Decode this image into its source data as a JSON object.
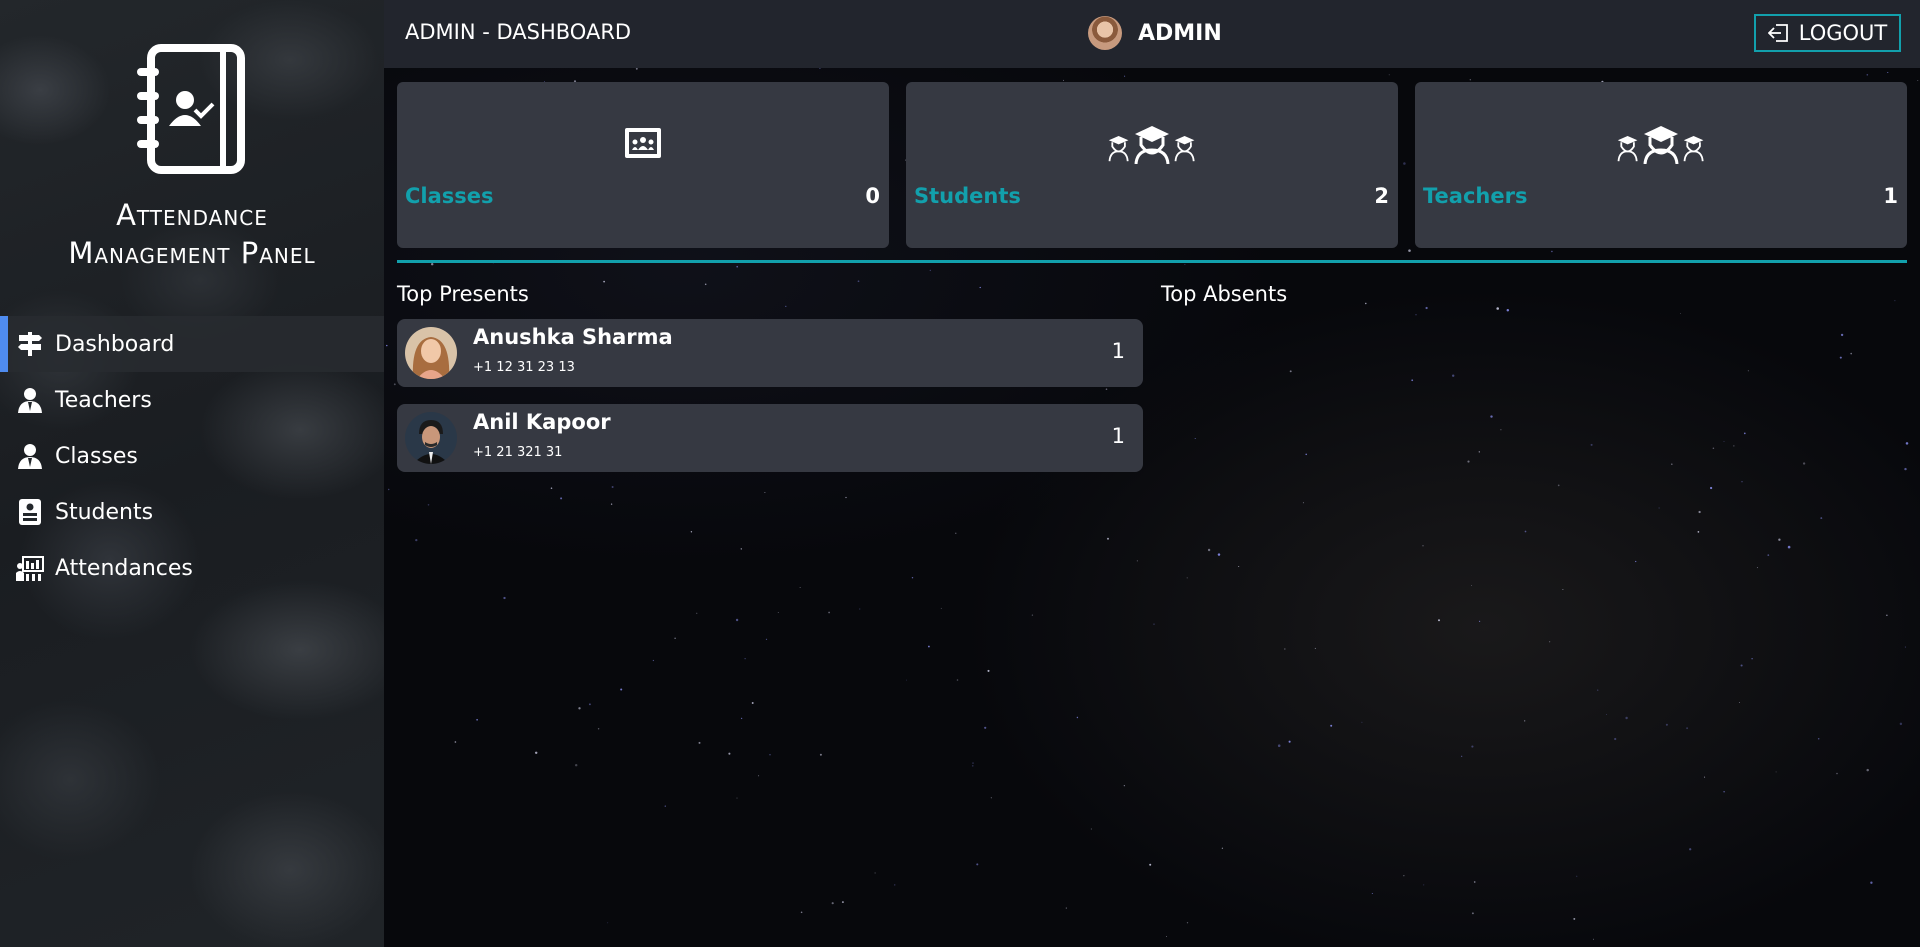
{
  "sidebar": {
    "app_title_line1": "Attendance",
    "app_title_line2": "Management Panel",
    "items": [
      {
        "label": "Dashboard",
        "icon": "signpost-icon",
        "active": true
      },
      {
        "label": "Teachers",
        "icon": "teacher-icon",
        "active": false
      },
      {
        "label": "Classes",
        "icon": "class-icon",
        "active": false
      },
      {
        "label": "Students",
        "icon": "student-id-icon",
        "active": false
      },
      {
        "label": "Attendances",
        "icon": "attendance-board-icon",
        "active": false
      }
    ]
  },
  "header": {
    "title": "ADMIN - DASHBOARD",
    "user_name": "ADMIN",
    "logout_label": "LOGOUT"
  },
  "stats": [
    {
      "label": "Classes",
      "count": "0",
      "icon": "chalkboard-icon"
    },
    {
      "label": "Students",
      "count": "2",
      "icon": "graduates-icon"
    },
    {
      "label": "Teachers",
      "count": "1",
      "icon": "graduates-icon"
    }
  ],
  "top_presents": {
    "title": "Top Presents",
    "rows": [
      {
        "name": "Anushka Sharma",
        "phone": "+1 12 31 23 13",
        "count": "1"
      },
      {
        "name": "Anil Kapoor",
        "phone": "+1 21 321 31",
        "count": "1"
      }
    ]
  },
  "top_absents": {
    "title": "Top Absents",
    "rows": []
  },
  "colors": {
    "accent": "#12a0ac",
    "active_indicator": "#4f8cf0",
    "card_bg": "#363942",
    "topbar_bg": "#22252d"
  }
}
